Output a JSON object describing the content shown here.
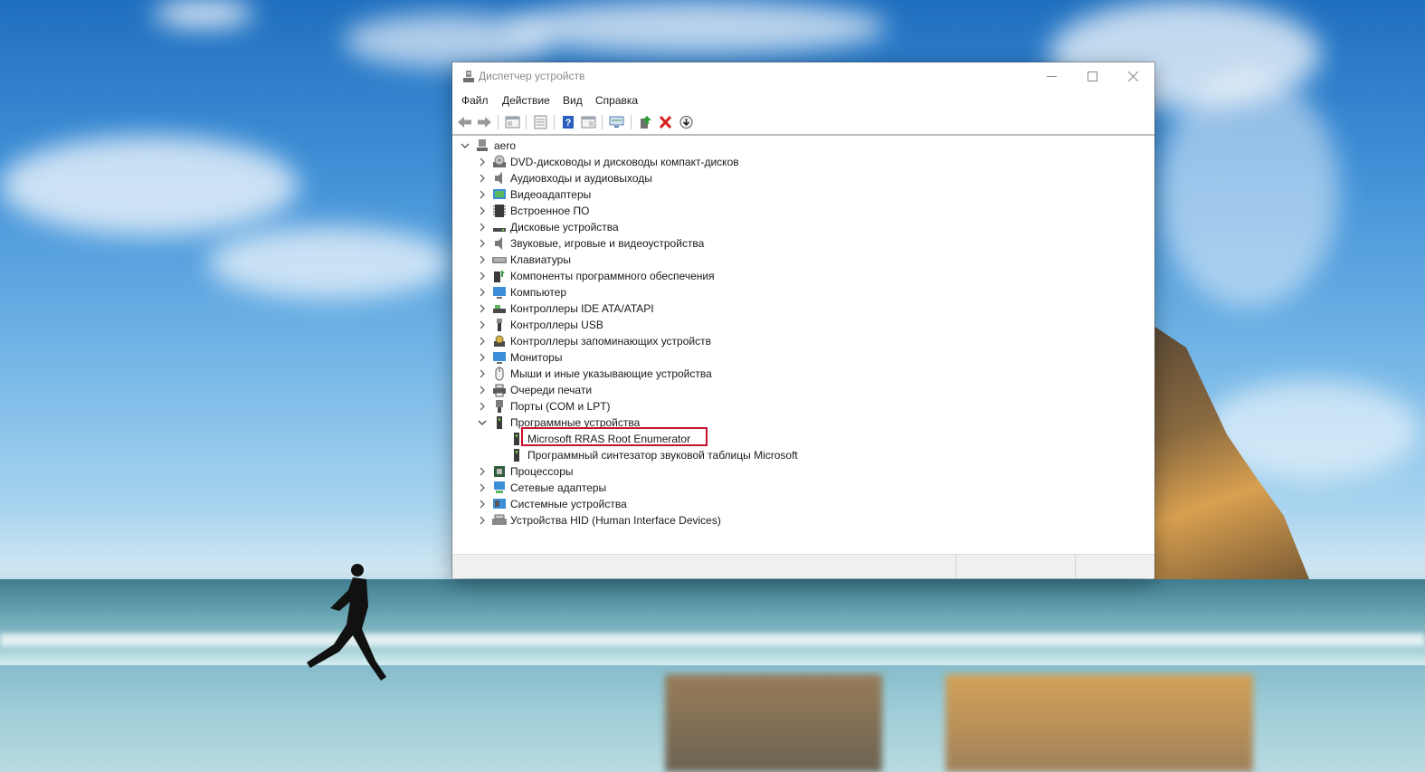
{
  "window": {
    "title": "Диспетчер устройств"
  },
  "menu": [
    "Файл",
    "Действие",
    "Вид",
    "Справка"
  ],
  "toolbar": [
    "back-icon",
    "forward-icon",
    "show-hide-tree-icon",
    "properties-icon",
    "help-icon",
    "view-icon",
    "monitor-scan-icon",
    "update-driver-icon",
    "uninstall-icon",
    "disable-icon"
  ],
  "tree": {
    "root": "aero",
    "categories": [
      {
        "label": "DVD-дисководы и дисководы компакт-дисков",
        "icon": "dvd-icon"
      },
      {
        "label": "Аудиовходы и аудиовыходы",
        "icon": "speaker-icon"
      },
      {
        "label": "Видеоадаптеры",
        "icon": "display-adapter-icon"
      },
      {
        "label": "Встроенное ПО",
        "icon": "firmware-icon"
      },
      {
        "label": "Дисковые устройства",
        "icon": "disk-drive-icon"
      },
      {
        "label": "Звуковые, игровые и видеоустройства",
        "icon": "speaker-icon"
      },
      {
        "label": "Клавиатуры",
        "icon": "keyboard-icon"
      },
      {
        "label": "Компоненты программного обеспечения",
        "icon": "software-component-icon"
      },
      {
        "label": "Компьютер",
        "icon": "computer-icon"
      },
      {
        "label": "Контроллеры IDE ATA/ATAPI",
        "icon": "ide-controller-icon"
      },
      {
        "label": "Контроллеры USB",
        "icon": "usb-icon"
      },
      {
        "label": "Контроллеры запоминающих устройств",
        "icon": "storage-controller-icon"
      },
      {
        "label": "Мониторы",
        "icon": "monitor-icon"
      },
      {
        "label": "Мыши и иные указывающие устройства",
        "icon": "mouse-icon"
      },
      {
        "label": "Очереди печати",
        "icon": "printer-icon"
      },
      {
        "label": "Порты (COM и LPT)",
        "icon": "port-icon"
      },
      {
        "label": "Программные устройства",
        "icon": "software-device-icon",
        "expanded": true,
        "children": [
          {
            "label": "Microsoft RRAS Root Enumerator",
            "highlighted": true
          },
          {
            "label": "Программный синтезатор звуковой таблицы Microsoft"
          }
        ]
      },
      {
        "label": "Процессоры",
        "icon": "processor-icon"
      },
      {
        "label": "Сетевые адаптеры",
        "icon": "network-adapter-icon"
      },
      {
        "label": "Системные устройства",
        "icon": "system-devices-icon"
      },
      {
        "label": "Устройства HID (Human Interface Devices)",
        "icon": "hid-icon"
      }
    ]
  },
  "colors": {
    "highlight_border": "#c8102e",
    "help_blue": "#2b5fbf",
    "uninstall_red": "#d81e1e"
  }
}
